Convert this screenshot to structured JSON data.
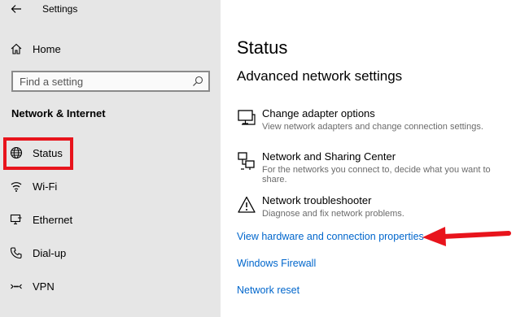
{
  "window": {
    "title": "Settings"
  },
  "sidebar": {
    "home_label": "Home",
    "search_placeholder": "Find a setting",
    "section_title": "Network & Internet",
    "items": [
      {
        "label": "Status",
        "icon": "globe-icon",
        "highlighted": true
      },
      {
        "label": "Wi-Fi",
        "icon": "wifi-icon"
      },
      {
        "label": "Ethernet",
        "icon": "ethernet-icon"
      },
      {
        "label": "Dial-up",
        "icon": "phone-icon"
      },
      {
        "label": "VPN",
        "icon": "vpn-icon"
      }
    ]
  },
  "main": {
    "title": "Status",
    "subtitle": "Advanced network settings",
    "options": [
      {
        "title": "Change adapter options",
        "description": "View network adapters and change connection settings.",
        "icon": "monitor-icon"
      },
      {
        "title": "Network and Sharing Center",
        "description": "For the networks you connect to, decide what you want to share.",
        "icon": "sharing-icon"
      },
      {
        "title": "Network troubleshooter",
        "description": "Diagnose and fix network problems.",
        "icon": "warning-icon"
      }
    ],
    "links": [
      "View hardware and connection properties",
      "Windows Firewall",
      "Network reset"
    ]
  },
  "colors": {
    "sidebar_bg": "#e6e6e6",
    "link": "#0066cc",
    "annotation_red": "#e8141c"
  }
}
